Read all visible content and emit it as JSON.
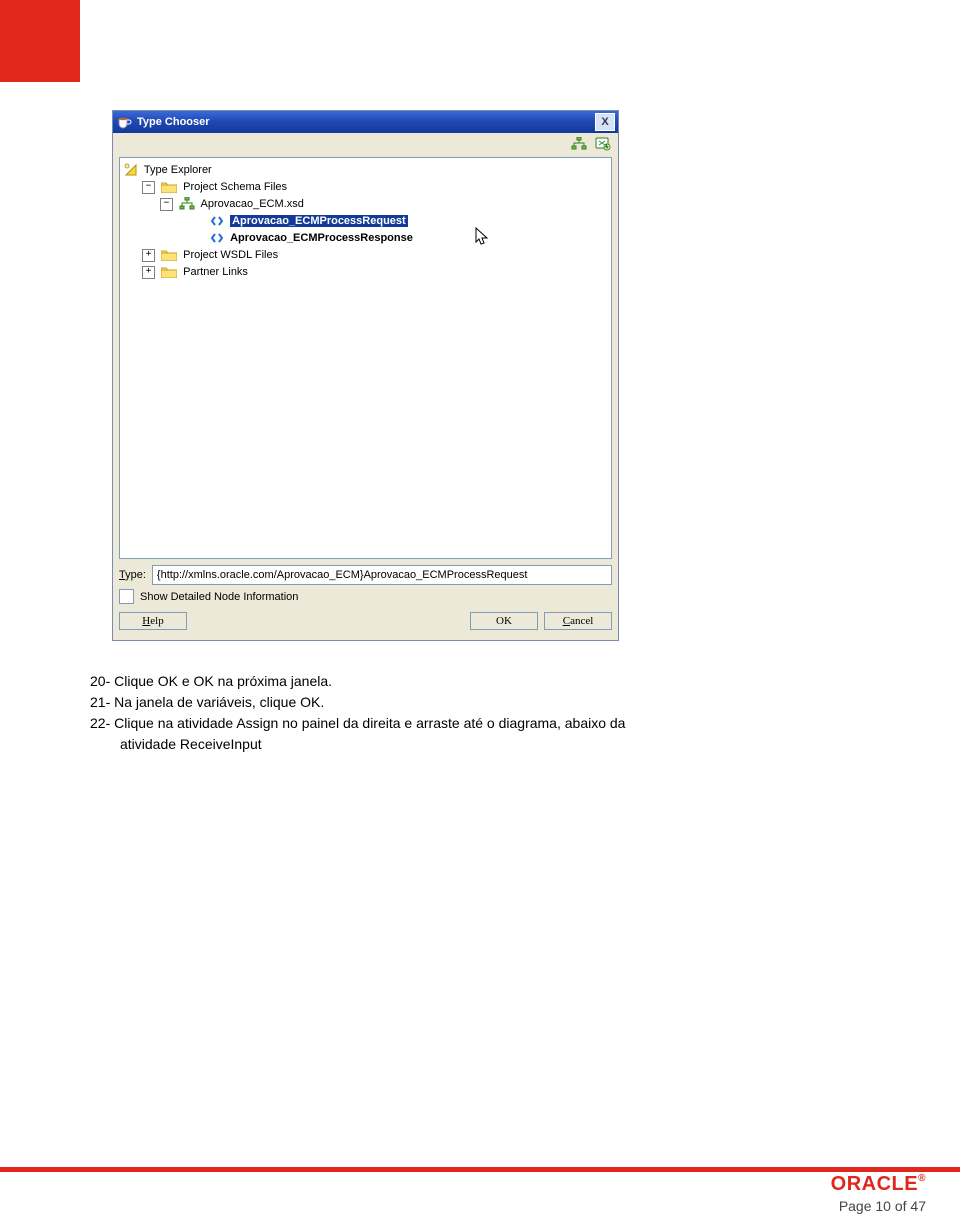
{
  "dialog": {
    "title": "Type Chooser",
    "close": "X",
    "tree": {
      "root": "Type Explorer",
      "schema_files": "Project Schema Files",
      "xsd": "Aprovacao_ECM.xsd",
      "req": "Aprovacao_ECMProcessRequest",
      "resp": "Aprovacao_ECMProcessResponse",
      "wsdl_files": "Project WSDL Files",
      "partner_links": "Partner Links"
    },
    "type_label": "Type:",
    "type_value": "{http://xmlns.oracle.com/Aprovacao_ECM}Aprovacao_ECMProcessRequest",
    "checkbox_label": "Show Detailed Node Information",
    "help": "Help",
    "ok": "OK",
    "cancel": "Cancel"
  },
  "instructions": {
    "l20": "20- Clique OK e OK na próxima janela.",
    "l21": "21- Na janela de variáveis, clique OK.",
    "l22a": "22- Clique na atividade Assign no painel da direita e arraste até o diagrama, abaixo da",
    "l22b": "atividade ReceiveInput"
  },
  "footer": {
    "brand": "ORACLE",
    "reg": "®",
    "page": "Page 10 of 47"
  }
}
